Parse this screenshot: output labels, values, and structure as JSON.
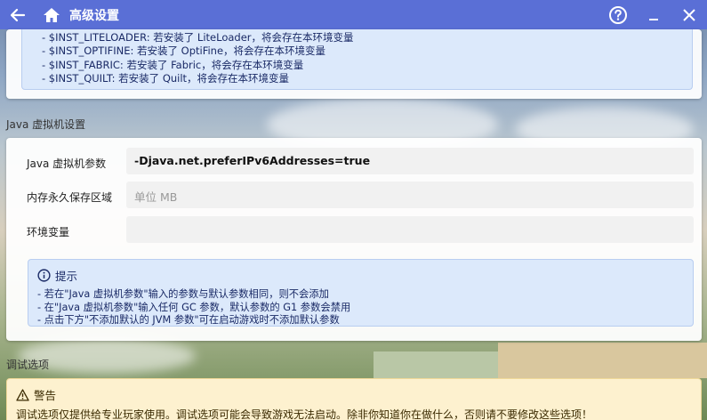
{
  "window": {
    "title": "高级设置",
    "icons": {
      "back": "arrow-left-icon",
      "home": "home-icon",
      "help": "help-circle-icon",
      "minimize": "minimize-icon",
      "close": "close-icon"
    }
  },
  "env_vars_list": [
    "- $INST_LITELOADER: 若安装了 LiteLoader，将会存在本环境变量",
    "- $INST_OPTIFINE: 若安装了 OptiFine，将会存在本环境变量",
    "- $INST_FABRIC: 若安装了 Fabric，将会存在本环境变量",
    "- $INST_QUILT: 若安装了 Quilt，将会存在本环境变量"
  ],
  "jvm_section": {
    "title": "Java 虚拟机设置",
    "java_args": {
      "label": "Java 虚拟机参数",
      "value": "-Djava.net.preferIPv6Addresses=true"
    },
    "permgen": {
      "label": "内存永久保存区域",
      "placeholder": "单位 MB"
    },
    "env": {
      "label": "环境变量",
      "value": ""
    },
    "tips": {
      "heading": "提示",
      "lines": [
        "- 若在\"Java 虚拟机参数\"输入的参数与默认参数相同，则不会添加",
        "- 在\"Java 虚拟机参数\"输入任何 GC 参数，默认参数的 G1 参数会禁用",
        "- 点击下方\"不添加默认的 JVM 参数\"可在启动游戏时不添加默认参数"
      ]
    }
  },
  "debug_section": {
    "title": "调试选项",
    "warning": {
      "heading": "警告",
      "text": "调试选项仅提供给专业玩家使用。调试选项可能会导致游戏无法启动。除非你知道你在做什么，否则请不要修改这些选项！"
    }
  },
  "colors": {
    "titlebar": "#5a6fd6",
    "info_bg": "#dce9fb",
    "warn_bg": "#fdf1cf"
  }
}
